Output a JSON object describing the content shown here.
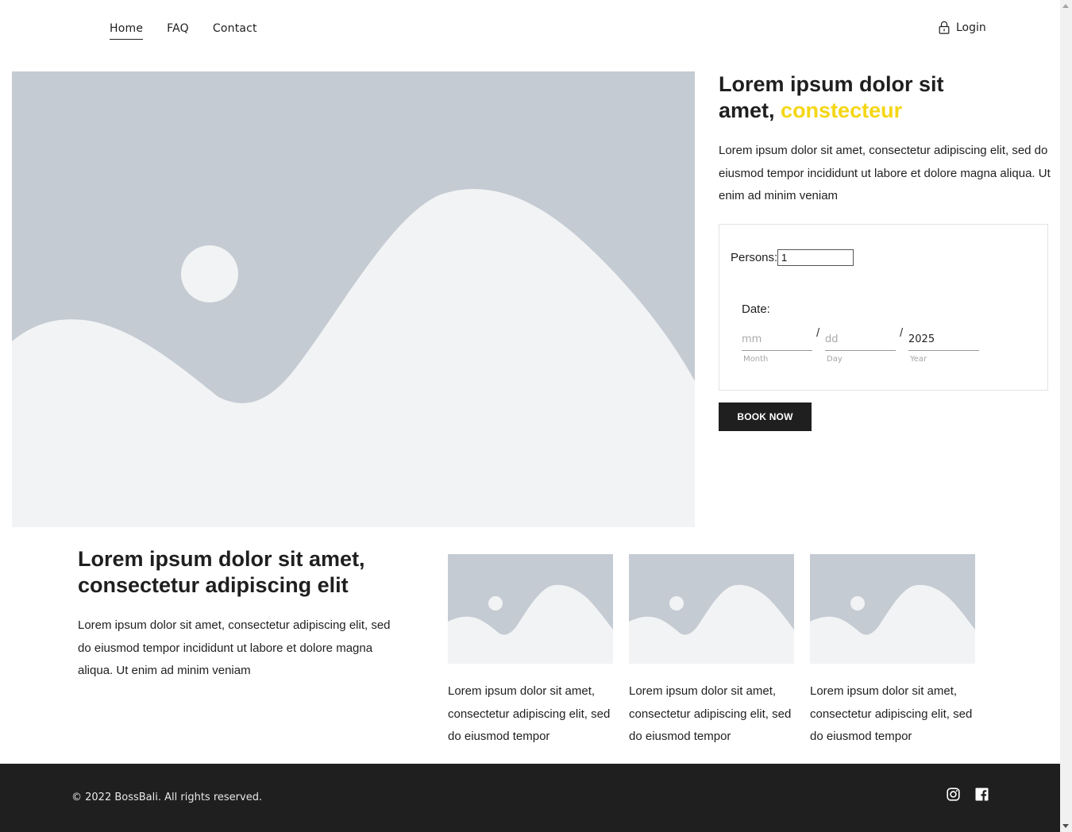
{
  "nav": {
    "items": [
      {
        "label": "Home",
        "active": true
      },
      {
        "label": "FAQ",
        "active": false
      },
      {
        "label": "Contact",
        "active": false
      }
    ],
    "login_label": "Login",
    "login_icon": "lock-icon"
  },
  "hero": {
    "image_icon": "image-placeholder-icon",
    "title_main": "Lorem ipsum dolor sit amet, ",
    "title_accent": "constecteur",
    "description": "Lorem ipsum dolor sit amet, consectetur adipiscing elit, sed do eiusmod tempor incididunt ut labore et dolore magna aliqua. Ut enim ad minim veniam"
  },
  "booking": {
    "persons_label": "Persons:",
    "persons_value": "1",
    "date_label": "Date:",
    "month": {
      "value": "",
      "placeholder": "mm",
      "sublabel": "Month"
    },
    "day": {
      "value": "",
      "placeholder": "dd",
      "sublabel": "Day"
    },
    "year": {
      "value": "2025",
      "placeholder": "",
      "sublabel": "Year"
    },
    "separator": "/",
    "button_label": "BOOK NOW"
  },
  "section": {
    "title": "Lorem ipsum dolor sit amet, consectetur adipiscing elit",
    "description": "Lorem ipsum dolor sit amet, consectetur adipiscing elit, sed do eiusmod tempor incididunt ut labore et dolore magna aliqua. Ut enim ad minim veniam"
  },
  "cards": [
    {
      "text": "Lorem ipsum dolor sit amet, consectetur adipiscing elit, sed do eiusmod tempor"
    },
    {
      "text": "Lorem ipsum dolor sit amet, consectetur adipiscing elit, sed do eiusmod tempor"
    },
    {
      "text": "Lorem ipsum dolor sit amet, consectetur adipiscing elit, sed do eiusmod tempor"
    }
  ],
  "footer": {
    "copyright": "© 2022 BossBali. All rights reserved.",
    "social_icons": [
      "instagram-icon",
      "facebook-icon"
    ]
  },
  "colors": {
    "accent": "#f5d614",
    "dark": "#1f1f1f",
    "placeholder_bg": "#c4cbd2",
    "placeholder_fg": "#f2f3f5"
  }
}
